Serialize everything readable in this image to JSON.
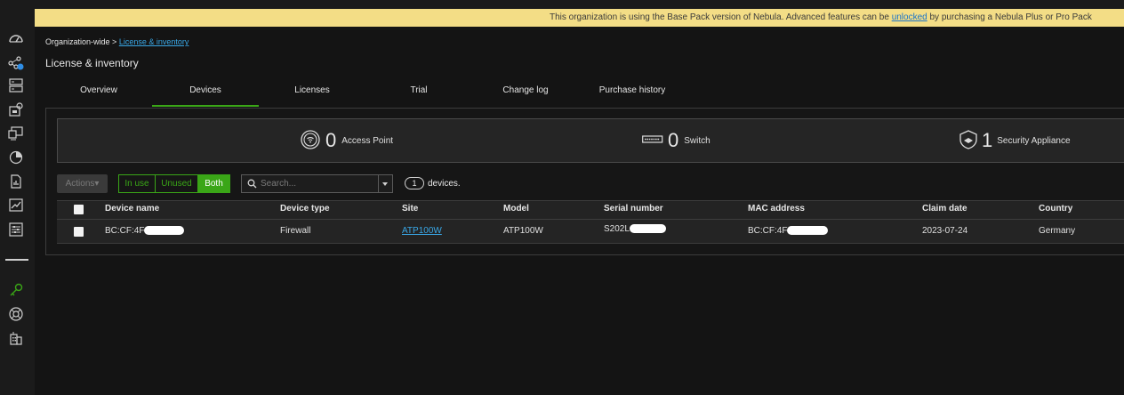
{
  "banner": {
    "text_before": "This organization is using the Base Pack version of Nebula. Advanced features can be ",
    "link": "unlocked",
    "text_after": " by purchasing a Nebula Plus or Pro Pack"
  },
  "breadcrumb": {
    "root": "Organization-wide >",
    "current": "License & inventory"
  },
  "page_title": "License & inventory",
  "tabs": [
    "Overview",
    "Devices",
    "Licenses",
    "Trial",
    "Change log",
    "Purchase history"
  ],
  "active_tab": "Devices",
  "summary": [
    {
      "count": "0",
      "label": "Access Point",
      "icon": "access-point-icon"
    },
    {
      "count": "0",
      "label": "Switch",
      "icon": "switch-icon"
    },
    {
      "count": "1",
      "label": "Security Appliance",
      "icon": "security-appliance-icon"
    }
  ],
  "toolbar": {
    "actions_label": "Actions▾",
    "filters": [
      "In use",
      "Unused",
      "Both"
    ],
    "active_filter": "Both",
    "search_placeholder": "Search...",
    "device_count": "1",
    "device_count_label": "devices."
  },
  "table": {
    "columns": [
      "Device name",
      "Device type",
      "Site",
      "Model",
      "Serial number",
      "MAC address",
      "Claim date",
      "Country"
    ],
    "rows": [
      {
        "device_name": "BC:CF:4F",
        "device_type": "Firewall",
        "site": "ATP100W",
        "model": "ATP100W",
        "serial_number": "S202L",
        "mac_address": "BC:CF:4F",
        "claim_date": "2023-07-24",
        "country": "Germany"
      }
    ]
  },
  "colors": {
    "accent_green": "#3aa617",
    "banner_bg": "#f3dd86",
    "link_blue": "#39a7e6",
    "background": "#141414"
  },
  "sidebar_icons": [
    "dashboard-icon",
    "topology-icon",
    "server-icon",
    "device-lock-icon",
    "monitor-icon",
    "pie-chart-icon",
    "report-icon",
    "trend-icon",
    "settings-sliders-icon",
    "key-icon",
    "help-center-icon",
    "building-icon"
  ]
}
